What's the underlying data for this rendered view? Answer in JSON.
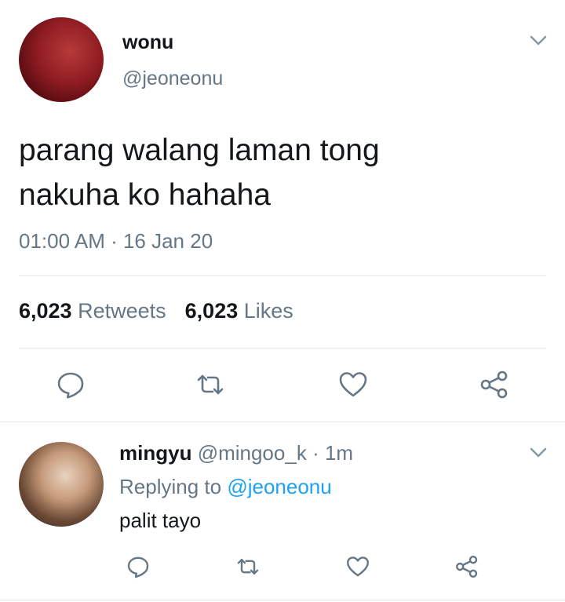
{
  "tweet": {
    "display_name": "wonu",
    "handle": "@jeoneonu",
    "text_line1": "parang walang laman tong",
    "text_line2": "nakuha ko hahaha",
    "timestamp": "01:00 AM · 16 Jan 20",
    "retweet_count": "6,023",
    "retweet_label": "Retweets",
    "like_count": "6,023",
    "like_label": "Likes"
  },
  "reply": {
    "display_name": "mingyu",
    "handle": "@mingoo_k",
    "separator": "·",
    "time": "1m",
    "replying_prefix": "Replying to",
    "replying_to": "@jeoneonu",
    "text": "palit tayo"
  },
  "icons": {
    "menu": "chevron-down-icon",
    "reply": "reply-bubble-icon",
    "retweet": "retweet-icon",
    "like": "heart-icon",
    "share": "share-icon"
  },
  "colors": {
    "text": "#14171a",
    "muted": "#657786",
    "link": "#1da1f2",
    "divider": "#e1e8ed"
  }
}
